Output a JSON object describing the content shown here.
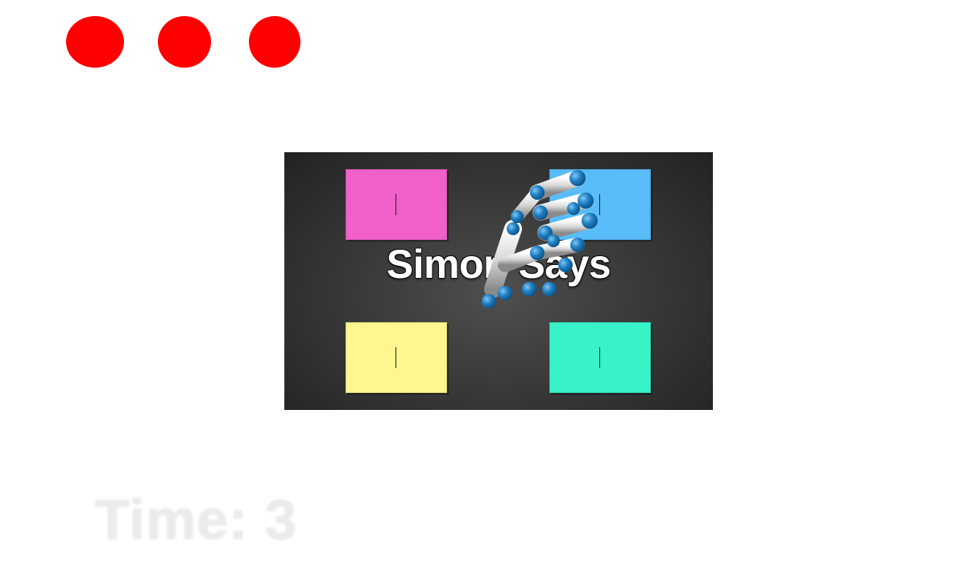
{
  "colors": {
    "life": "#ff0000",
    "board_background": "#333333",
    "pad_pink": "#f060c8",
    "pad_blue": "#58bcf8",
    "pad_yellow": "#fff690",
    "pad_teal": "#38f2c8",
    "hand_joint": "#1e7fc2",
    "hand_bone": "#e6e6e6"
  },
  "lives": {
    "count": 3,
    "icon": "red-circle-icon"
  },
  "board": {
    "title": "Simon Says",
    "pads": [
      {
        "color_name": "pink",
        "icon": "pad-marker-icon"
      },
      {
        "color_name": "blue",
        "icon": "pad-marker-icon"
      },
      {
        "color_name": "yellow",
        "icon": "pad-marker-icon"
      },
      {
        "color_name": "teal",
        "icon": "pad-marker-icon"
      }
    ],
    "cursor_icon": "tracked-hand-icon"
  },
  "timer": {
    "text": "Time: 3"
  }
}
